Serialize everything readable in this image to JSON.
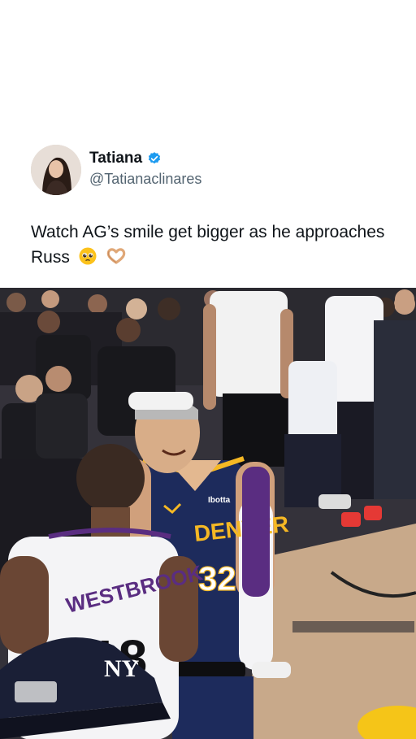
{
  "tweet": {
    "author": {
      "display_name": "Tatiana",
      "handle": "@Tatianaclinares",
      "verified": true
    },
    "text": "Watch AG’s smile get bigger as he approaches Russ",
    "emojis": [
      "pleading-face",
      "heart-hands"
    ],
    "media": {
      "jersey_front_text": "DENVER",
      "jersey_front_number": "32",
      "jersey_back_text": "WESTBROOK",
      "jersey_back_number": "18",
      "cap_logo": "NY",
      "shoe_brand": "Ibotta"
    }
  },
  "colors": {
    "verified_blue": "#1d9bf0",
    "handle_gray": "#536471",
    "nuggets_navy": "#1d2b5c",
    "nuggets_gold": "#f5b824",
    "kings_purple": "#5a2d81"
  }
}
